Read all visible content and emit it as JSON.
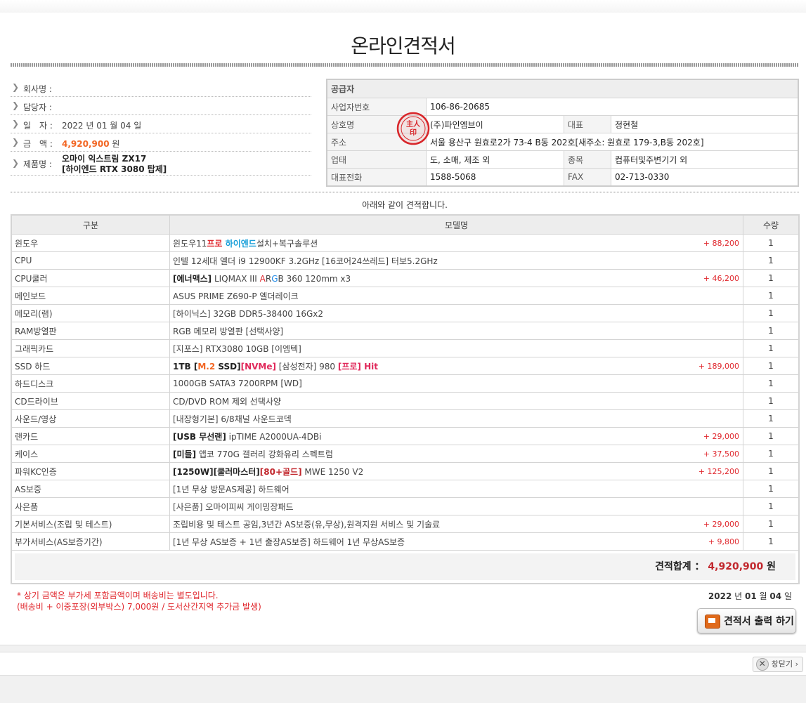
{
  "title": "온라인견적서",
  "customer": {
    "company_label": "회사명 :",
    "company_value": "",
    "contact_label": "담당자 :",
    "contact_value": "",
    "date_label": "일　자 :",
    "date_value": "2022 년 01 월 04 일",
    "amount_label": "금　액 :",
    "amount_value": "4,920,900",
    "amount_unit": "원",
    "product_label": "제품명 :",
    "product_line1": "오마이 익스트림 ZX17",
    "product_line2": "[하이엔드 RTX 3080 탑제]"
  },
  "supplier": {
    "header": "공급자",
    "bizno_label": "사업자번호",
    "bizno": "106-86-20685",
    "name_label": "상호명",
    "name": "(주)파인엠브이",
    "ceo_label": "대표",
    "ceo": "정현철",
    "addr_label": "주소",
    "addr": "서울 용산구 원효로2가 73-4 B동 202호[새주소: 원효로 179-3,B동 202호]",
    "biz_label": "업태",
    "biz": "도, 소매, 제조 외",
    "item_label": "종목",
    "item": "컴퓨터및주변기기 외",
    "tel_label": "대표전화",
    "tel": "1588-5068",
    "fax_label": "FAX",
    "fax": "02-713-0330",
    "stamp_text": "主人印"
  },
  "intro": "아래와 같이 견적합니다.",
  "table_headers": {
    "category": "구분",
    "model": "모델명",
    "qty": "수량"
  },
  "items": [
    {
      "category": "윈도우",
      "parts": [
        [
          "",
          "윈도우11"
        ],
        [
          "red",
          "프로 "
        ],
        [
          "bl",
          "하이엔드"
        ],
        [
          "",
          "설치+복구솔루션"
        ]
      ],
      "price": "+ 88,200",
      "qty": "1"
    },
    {
      "category": "CPU",
      "parts": [
        [
          "",
          "인텔 12세대 엘더 i9 12900KF 3.2GHz [16코어24쓰레드] 터보5.2GHz"
        ]
      ],
      "price": "",
      "qty": "1"
    },
    {
      "category": "CPU쿨러",
      "parts": [
        [
          "b",
          "[에너맥스]"
        ],
        [
          "",
          " LIQMAX III "
        ],
        [
          "a-red",
          "A"
        ],
        [
          "",
          "R"
        ],
        [
          "g-blue",
          "G"
        ],
        [
          "",
          "B 360 120mm x3"
        ]
      ],
      "price": "+ 46,200",
      "qty": "1"
    },
    {
      "category": "메인보드",
      "parts": [
        [
          "",
          "ASUS PRIME Z690-P 엘더레이크"
        ]
      ],
      "price": "",
      "qty": "1"
    },
    {
      "category": "메모리(램)",
      "parts": [
        [
          "",
          "[하이닉스] 32GB DDR5-38400 16Gx2"
        ]
      ],
      "price": "",
      "qty": "1"
    },
    {
      "category": "RAM방열판",
      "parts": [
        [
          "",
          "RGB 메모리 방열판 [선택사양]"
        ]
      ],
      "price": "",
      "qty": "1"
    },
    {
      "category": "그래픽카드",
      "parts": [
        [
          "",
          "[지포스] RTX3080 10GB [이엠텍]"
        ]
      ],
      "price": "",
      "qty": "1"
    },
    {
      "category": "SSD 하드",
      "parts": [
        [
          "b",
          "1TB ["
        ],
        [
          "or",
          "M.2"
        ],
        [
          "b",
          " SSD]"
        ],
        [
          "pk",
          "[NVMe]"
        ],
        [
          "",
          " [삼성전자] 980 "
        ],
        [
          "pk",
          "[프로] Hit"
        ]
      ],
      "price": "+ 189,000",
      "qty": "1"
    },
    {
      "category": "하드디스크",
      "parts": [
        [
          "",
          "1000GB SATA3 7200RPM [WD]"
        ]
      ],
      "price": "",
      "qty": "1"
    },
    {
      "category": "CD드라이브",
      "parts": [
        [
          "",
          "CD/DVD ROM 제외 선택사양"
        ]
      ],
      "price": "",
      "qty": "1"
    },
    {
      "category": "사운드/영상",
      "parts": [
        [
          "",
          "[내장형기본] 6/8채널 사운드코덱"
        ]
      ],
      "price": "",
      "qty": "1"
    },
    {
      "category": "랜카드",
      "parts": [
        [
          "b",
          "[USB 무선랜]"
        ],
        [
          "",
          " ipTIME A2000UA-4DBi"
        ]
      ],
      "price": "+ 29,000",
      "qty": "1"
    },
    {
      "category": "케이스",
      "parts": [
        [
          "b",
          "[미들]"
        ],
        [
          "",
          " 앱코 770G 갤러리 강화유리 스펙트럼"
        ]
      ],
      "price": "+ 37,500",
      "qty": "1"
    },
    {
      "category": "파워KC인증",
      "parts": [
        [
          "b",
          "[1250W][쿨러마스터]"
        ],
        [
          "rd",
          "[80+골드]"
        ],
        [
          "",
          " MWE 1250 V2"
        ]
      ],
      "price": "+ 125,200",
      "qty": "1"
    },
    {
      "category": "AS보증",
      "parts": [
        [
          "",
          "[1년 무상 방문AS제공] 하드웨어"
        ]
      ],
      "price": "",
      "qty": "1"
    },
    {
      "category": "사은품",
      "parts": [
        [
          "",
          "[사은품] 오마이피씨 게이밍장패드"
        ]
      ],
      "price": "",
      "qty": "1"
    },
    {
      "category": "기본서비스(조립 및 테스트)",
      "parts": [
        [
          "",
          "조립비용 및 테스트 공임,3년간 AS보증(유,무상),원격지원 서비스 및 기술료"
        ]
      ],
      "price": "+ 29,000",
      "qty": "1"
    },
    {
      "category": "부가서비스(AS보증기간)",
      "parts": [
        [
          "",
          "[1년 무상 AS보증 + 1년 출장AS보증] 하드웨어 1년 무상AS보증"
        ]
      ],
      "price": "+ 9,800",
      "qty": "1"
    }
  ],
  "total": {
    "label": "견적합계 ：",
    "value": "4,920,900",
    "unit": "원"
  },
  "notes": {
    "line1": "* 상기 금액은 부가세 포함금액이며 배송비는 별도입니다.",
    "line2": "(배송비 + 이중포장(외부박스) 7,000원 / 도서산간지역 추가금 발생)"
  },
  "footer_date": {
    "year": "2022",
    "year_unit": "년",
    "month": "01",
    "month_unit": "월",
    "day": "04",
    "day_unit": "일"
  },
  "print_button": "견적서 출력 하기",
  "close_button": "창닫기"
}
